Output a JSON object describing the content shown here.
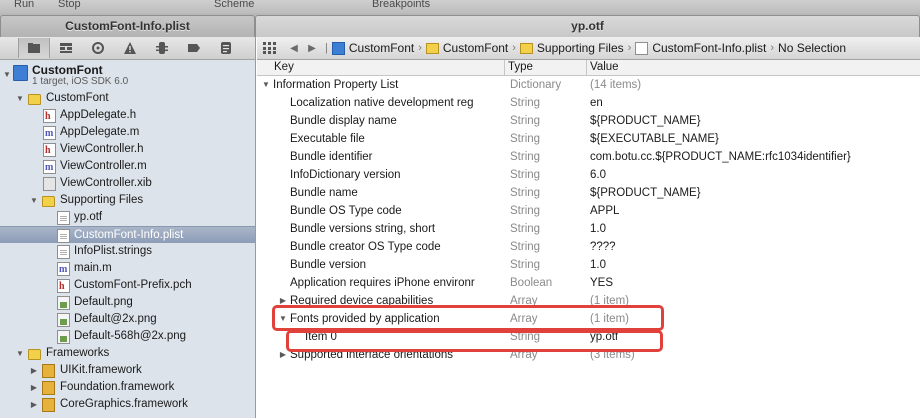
{
  "toolbar": {
    "run": "Run",
    "stop": "Stop",
    "scheme": "Scheme",
    "breakpoints": "Breakpoints"
  },
  "tabs": [
    {
      "label": "CustomFont-Info.plist"
    },
    {
      "label": "yp.otf"
    }
  ],
  "navigator": {
    "project": {
      "name": "CustomFont",
      "subtitle": "1 target, iOS SDK 6.0"
    },
    "items": [
      {
        "label": "CustomFont",
        "kind": "folder"
      },
      {
        "label": "AppDelegate.h",
        "kind": "h"
      },
      {
        "label": "AppDelegate.m",
        "kind": "m"
      },
      {
        "label": "ViewController.h",
        "kind": "h"
      },
      {
        "label": "ViewController.m",
        "kind": "m"
      },
      {
        "label": "ViewController.xib",
        "kind": "xib"
      },
      {
        "label": "Supporting Files",
        "kind": "folder"
      },
      {
        "label": "yp.otf",
        "kind": "plain"
      },
      {
        "label": "CustomFont-Info.plist",
        "kind": "plain",
        "selected": true
      },
      {
        "label": "InfoPlist.strings",
        "kind": "plain"
      },
      {
        "label": "main.m",
        "kind": "m"
      },
      {
        "label": "CustomFont-Prefix.pch",
        "kind": "h"
      },
      {
        "label": "Default.png",
        "kind": "png"
      },
      {
        "label": "Default@2x.png",
        "kind": "png"
      },
      {
        "label": "Default-568h@2x.png",
        "kind": "png"
      },
      {
        "label": "Frameworks",
        "kind": "folder"
      },
      {
        "label": "UIKit.framework",
        "kind": "framework"
      },
      {
        "label": "Foundation.framework",
        "kind": "framework"
      },
      {
        "label": "CoreGraphics.framework",
        "kind": "framework"
      }
    ]
  },
  "jumpbar": {
    "crumbs": [
      "CustomFont",
      "CustomFont",
      "Supporting Files",
      "CustomFont-Info.plist",
      "No Selection"
    ]
  },
  "plist": {
    "columns": {
      "key": "Key",
      "type": "Type",
      "value": "Value"
    },
    "rows": [
      {
        "key": "Information Property List",
        "type": "Dictionary",
        "value": "(14 items)"
      },
      {
        "key": "Localization native development reg",
        "type": "String",
        "value": "en"
      },
      {
        "key": "Bundle display name",
        "type": "String",
        "value": "${PRODUCT_NAME}"
      },
      {
        "key": "Executable file",
        "type": "String",
        "value": "${EXECUTABLE_NAME}"
      },
      {
        "key": "Bundle identifier",
        "type": "String",
        "value": "com.botu.cc.${PRODUCT_NAME:rfc1034identifier}"
      },
      {
        "key": "InfoDictionary version",
        "type": "String",
        "value": "6.0"
      },
      {
        "key": "Bundle name",
        "type": "String",
        "value": "${PRODUCT_NAME}"
      },
      {
        "key": "Bundle OS Type code",
        "type": "String",
        "value": "APPL"
      },
      {
        "key": "Bundle versions string, short",
        "type": "String",
        "value": "1.0"
      },
      {
        "key": "Bundle creator OS Type code",
        "type": "String",
        "value": "????"
      },
      {
        "key": "Bundle version",
        "type": "String",
        "value": "1.0"
      },
      {
        "key": "Application requires iPhone environr",
        "type": "Boolean",
        "value": "YES"
      },
      {
        "key": "Required device capabilities",
        "type": "Array",
        "value": "(1 item)"
      },
      {
        "key": "Fonts provided by application",
        "type": "Array",
        "value": "(1 item)"
      },
      {
        "key": "Item 0",
        "type": "String",
        "value": "yp.otf"
      },
      {
        "key": "Supported interface orientations",
        "type": "Array",
        "value": "(3 items)"
      }
    ]
  },
  "colors": {
    "highlight": "#e0413a",
    "selection": "#8d9db7",
    "sidebar": "#dde3ea"
  }
}
